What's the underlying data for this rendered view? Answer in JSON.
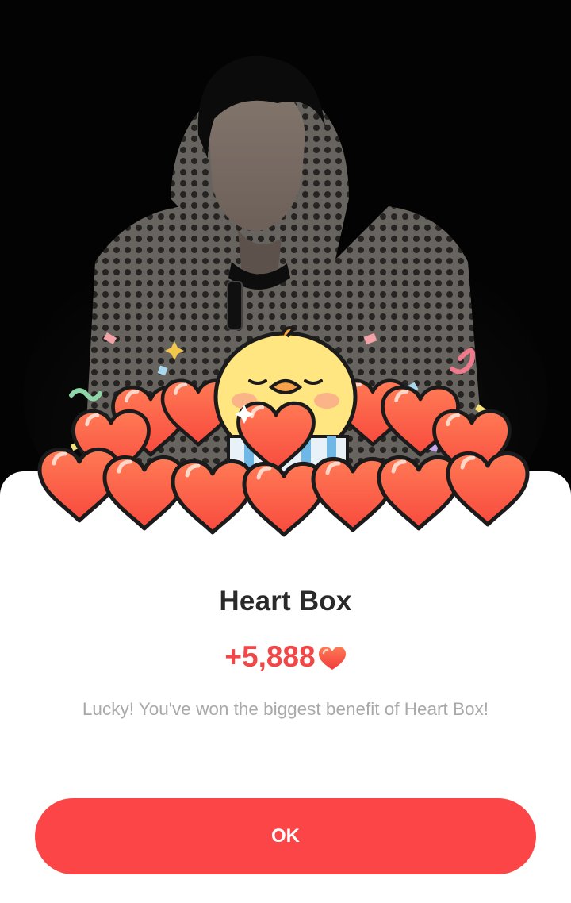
{
  "dialog": {
    "title": "Heart Box",
    "reward_amount": "+5,888",
    "reward_icon": "heart-icon",
    "message": "Lucky! You've won the biggest benefit of Heart Box!",
    "ok_label": "OK"
  },
  "colors": {
    "accent": "#fb4546",
    "reward_text": "#f04848",
    "heart_fill": "#ff6a4a",
    "chick_yellow": "#ffe680"
  }
}
